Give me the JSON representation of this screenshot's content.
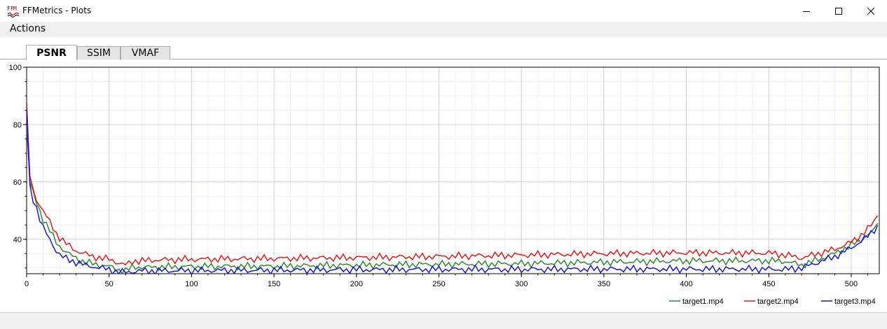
{
  "window": {
    "title": "FFMetrics - Plots",
    "icon": "ffm-logo-icon",
    "controls": [
      "minimize-icon",
      "maximize-icon",
      "close-icon"
    ]
  },
  "menu": {
    "actions_label": "Actions"
  },
  "tabs": [
    {
      "label": "PSNR",
      "selected": true
    },
    {
      "label": "SSIM",
      "selected": false
    },
    {
      "label": "VMAF",
      "selected": false
    }
  ],
  "chart_data": {
    "type": "line",
    "title": "",
    "xlabel": "",
    "ylabel": "",
    "xlim": [
      0,
      517
    ],
    "ylim": [
      28,
      100
    ],
    "xticks": [
      0,
      50,
      100,
      150,
      200,
      250,
      300,
      350,
      400,
      450,
      500
    ],
    "yticks": [
      40,
      60,
      80,
      100
    ],
    "grid": true,
    "legend_position": "bottom-right",
    "series": [
      {
        "name": "target1.mp4",
        "color": "#2e8b2e",
        "x": [
          0,
          2,
          4,
          6,
          8,
          10,
          12,
          15,
          18,
          21,
          25,
          30,
          35,
          40,
          45,
          50,
          55,
          60,
          65,
          70,
          80,
          100,
          150,
          200,
          250,
          300,
          350,
          400,
          450,
          460,
          470,
          480,
          490,
          500,
          505,
          510,
          515,
          517
        ],
        "y": [
          80,
          60,
          56,
          53,
          50,
          47,
          45,
          42,
          39,
          37,
          35,
          33.5,
          32,
          31.5,
          31,
          30.5,
          29.5,
          29,
          30.5,
          30.2,
          30.3,
          30.5,
          30.6,
          31,
          31.3,
          31.5,
          32,
          32.5,
          32.5,
          32.3,
          31,
          33,
          35,
          38,
          39.5,
          41.5,
          43.5,
          49
        ]
      },
      {
        "name": "target2.mp4",
        "color": "#e81818",
        "x": [
          0,
          2,
          4,
          6,
          8,
          10,
          12,
          15,
          18,
          21,
          25,
          30,
          35,
          40,
          45,
          50,
          55,
          60,
          65,
          70,
          80,
          100,
          150,
          200,
          250,
          300,
          350,
          400,
          450,
          460,
          470,
          480,
          490,
          500,
          505,
          510,
          515,
          517
        ],
        "y": [
          88,
          62,
          57,
          54,
          52,
          50,
          48,
          45,
          42,
          40,
          38,
          36,
          35,
          34,
          33.5,
          33,
          32,
          31,
          32.5,
          32.5,
          32.8,
          33,
          33.3,
          33.6,
          34,
          34.5,
          35,
          35.3,
          35.2,
          34.5,
          33.5,
          35,
          36.5,
          39,
          41,
          43.5,
          47,
          51
        ]
      },
      {
        "name": "target3.mp4",
        "color": "#1818d8",
        "x": [
          0,
          2,
          4,
          6,
          8,
          10,
          12,
          15,
          18,
          21,
          25,
          30,
          35,
          40,
          45,
          50,
          55,
          60,
          65,
          70,
          80,
          100,
          150,
          200,
          250,
          300,
          350,
          400,
          450,
          460,
          470,
          480,
          490,
          500,
          505,
          510,
          515,
          517
        ],
        "y": [
          85,
          59,
          54,
          51,
          47,
          44,
          42,
          39,
          36,
          34,
          33,
          32,
          31,
          30.5,
          30,
          29.5,
          28.7,
          28.5,
          28.8,
          29,
          29,
          29.1,
          29.2,
          29.4,
          29.5,
          29.5,
          29.6,
          29.6,
          29.6,
          29.5,
          30,
          32,
          34,
          37,
          39,
          41,
          44,
          45
        ]
      }
    ]
  }
}
